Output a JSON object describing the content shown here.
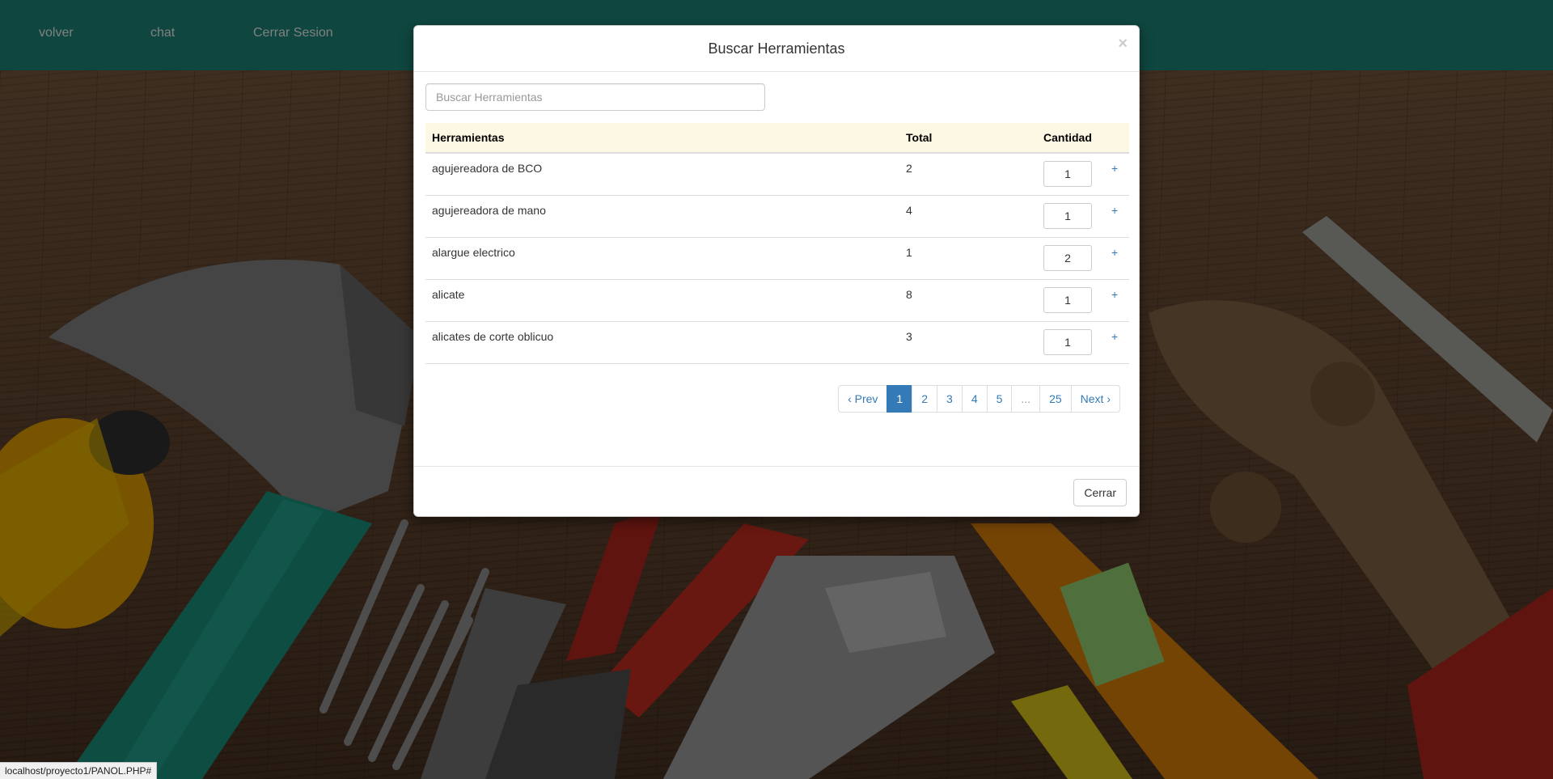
{
  "navbar": {
    "links": [
      "volver",
      "chat",
      "Cerrar Sesion"
    ]
  },
  "modal": {
    "title": "Buscar Herramientas",
    "close_symbol": "×",
    "search_placeholder": "Buscar Herramientas",
    "columns": [
      "Herramientas",
      "Total",
      "Cantidad"
    ],
    "rows": [
      {
        "name": "agujereadora de BCO",
        "total": "2",
        "cantidad": "1"
      },
      {
        "name": "agujereadora de mano",
        "total": "4",
        "cantidad": "1"
      },
      {
        "name": "alargue electrico",
        "total": "1",
        "cantidad": "2"
      },
      {
        "name": "alicate",
        "total": "8",
        "cantidad": "1"
      },
      {
        "name": "alicates de corte oblicuo",
        "total": "3",
        "cantidad": "1"
      }
    ],
    "add_symbol": "+",
    "pagination": [
      "‹ Prev",
      "1",
      "2",
      "3",
      "4",
      "5",
      "...",
      "25",
      "Next ›"
    ],
    "pagination_active": "1",
    "footer_button": "Cerrar"
  },
  "statusbar": {
    "url": "localhost/proyecto1/PANOL.PHP#"
  },
  "colors": {
    "navbar": "#1f8f80",
    "table_header": "#fcf8e3",
    "link": "#337ab7"
  }
}
